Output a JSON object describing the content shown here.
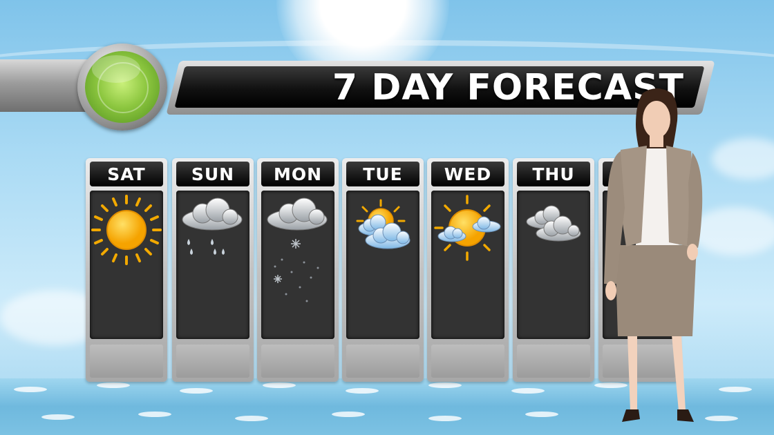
{
  "header": {
    "title": "7 DAY FORECAST"
  },
  "days": [
    {
      "label": "SAT",
      "icon": "sunny-icon"
    },
    {
      "label": "SUN",
      "icon": "rain-icon"
    },
    {
      "label": "MON",
      "icon": "snow-icon"
    },
    {
      "label": "TUE",
      "icon": "partly-cloudy-icon"
    },
    {
      "label": "WED",
      "icon": "partly-sunny-icon"
    },
    {
      "label": "THU",
      "icon": "cloudy-icon"
    },
    {
      "label": "",
      "icon": ""
    }
  ],
  "colors": {
    "sky": "#a9daf4",
    "sun": "#f7b500",
    "screen": "#333333",
    "radar": "#8cc63f"
  }
}
